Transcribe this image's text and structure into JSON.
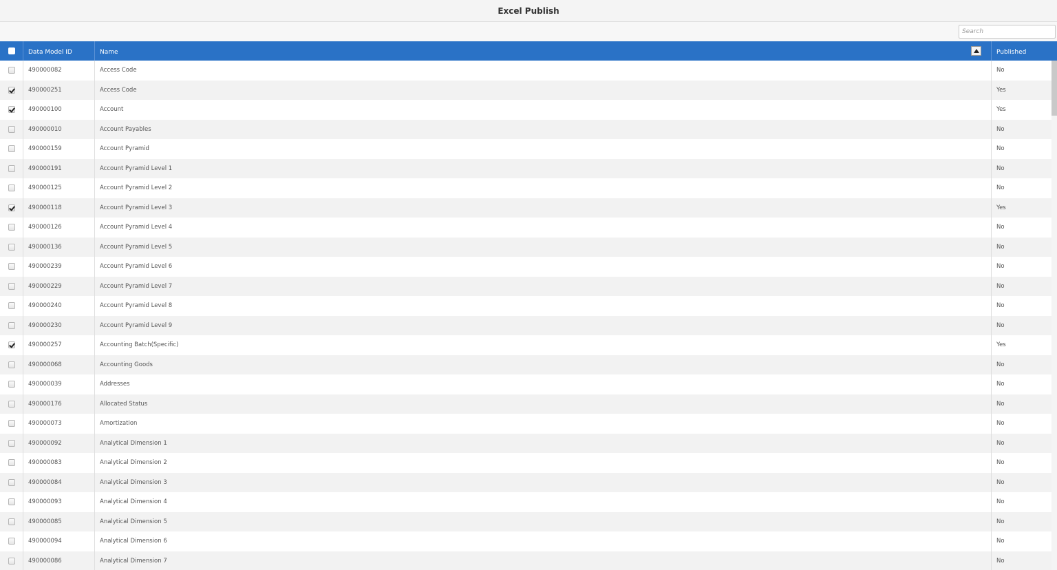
{
  "window": {
    "title": "Excel Publish"
  },
  "search": {
    "placeholder": "Search",
    "value": ""
  },
  "table": {
    "columns": {
      "id": "Data Model ID",
      "name": "Name",
      "published": "Published"
    },
    "rows": [
      {
        "id": "490000082",
        "name": "Access Code",
        "published": "No",
        "checked": false
      },
      {
        "id": "490000251",
        "name": "Access Code",
        "published": "Yes",
        "checked": true
      },
      {
        "id": "490000100",
        "name": "Account",
        "published": "Yes",
        "checked": true
      },
      {
        "id": "490000010",
        "name": "Account Payables",
        "published": "No",
        "checked": false
      },
      {
        "id": "490000159",
        "name": "Account Pyramid",
        "published": "No",
        "checked": false
      },
      {
        "id": "490000191",
        "name": "Account Pyramid Level 1",
        "published": "No",
        "checked": false
      },
      {
        "id": "490000125",
        "name": "Account Pyramid Level 2",
        "published": "No",
        "checked": false
      },
      {
        "id": "490000118",
        "name": "Account Pyramid Level 3",
        "published": "Yes",
        "checked": true
      },
      {
        "id": "490000126",
        "name": "Account Pyramid Level 4",
        "published": "No",
        "checked": false
      },
      {
        "id": "490000136",
        "name": "Account Pyramid Level 5",
        "published": "No",
        "checked": false
      },
      {
        "id": "490000239",
        "name": "Account Pyramid Level 6",
        "published": "No",
        "checked": false
      },
      {
        "id": "490000229",
        "name": "Account Pyramid Level 7",
        "published": "No",
        "checked": false
      },
      {
        "id": "490000240",
        "name": "Account Pyramid Level 8",
        "published": "No",
        "checked": false
      },
      {
        "id": "490000230",
        "name": "Account Pyramid Level 9",
        "published": "No",
        "checked": false
      },
      {
        "id": "490000257",
        "name": "Accounting Batch(Specific)",
        "published": "Yes",
        "checked": true
      },
      {
        "id": "490000068",
        "name": "Accounting Goods",
        "published": "No",
        "checked": false
      },
      {
        "id": "490000039",
        "name": "Addresses",
        "published": "No",
        "checked": false
      },
      {
        "id": "490000176",
        "name": "Allocated Status",
        "published": "No",
        "checked": false
      },
      {
        "id": "490000073",
        "name": "Amortization",
        "published": "No",
        "checked": false
      },
      {
        "id": "490000092",
        "name": "Analytical Dimension 1",
        "published": "No",
        "checked": false
      },
      {
        "id": "490000083",
        "name": "Analytical Dimension 2",
        "published": "No",
        "checked": false
      },
      {
        "id": "490000084",
        "name": "Analytical Dimension 3",
        "published": "No",
        "checked": false
      },
      {
        "id": "490000093",
        "name": "Analytical Dimension 4",
        "published": "No",
        "checked": false
      },
      {
        "id": "490000085",
        "name": "Analytical Dimension 5",
        "published": "No",
        "checked": false
      },
      {
        "id": "490000094",
        "name": "Analytical Dimension 6",
        "published": "No",
        "checked": false
      },
      {
        "id": "490000086",
        "name": "Analytical Dimension 7",
        "published": "No",
        "checked": false
      }
    ]
  },
  "icons": {
    "sort": "sort-ascending-icon",
    "checkbox": "checkbox-icon"
  },
  "colors": {
    "header_bg": "#2a72c6",
    "row_alt": "#f2f2f2"
  }
}
